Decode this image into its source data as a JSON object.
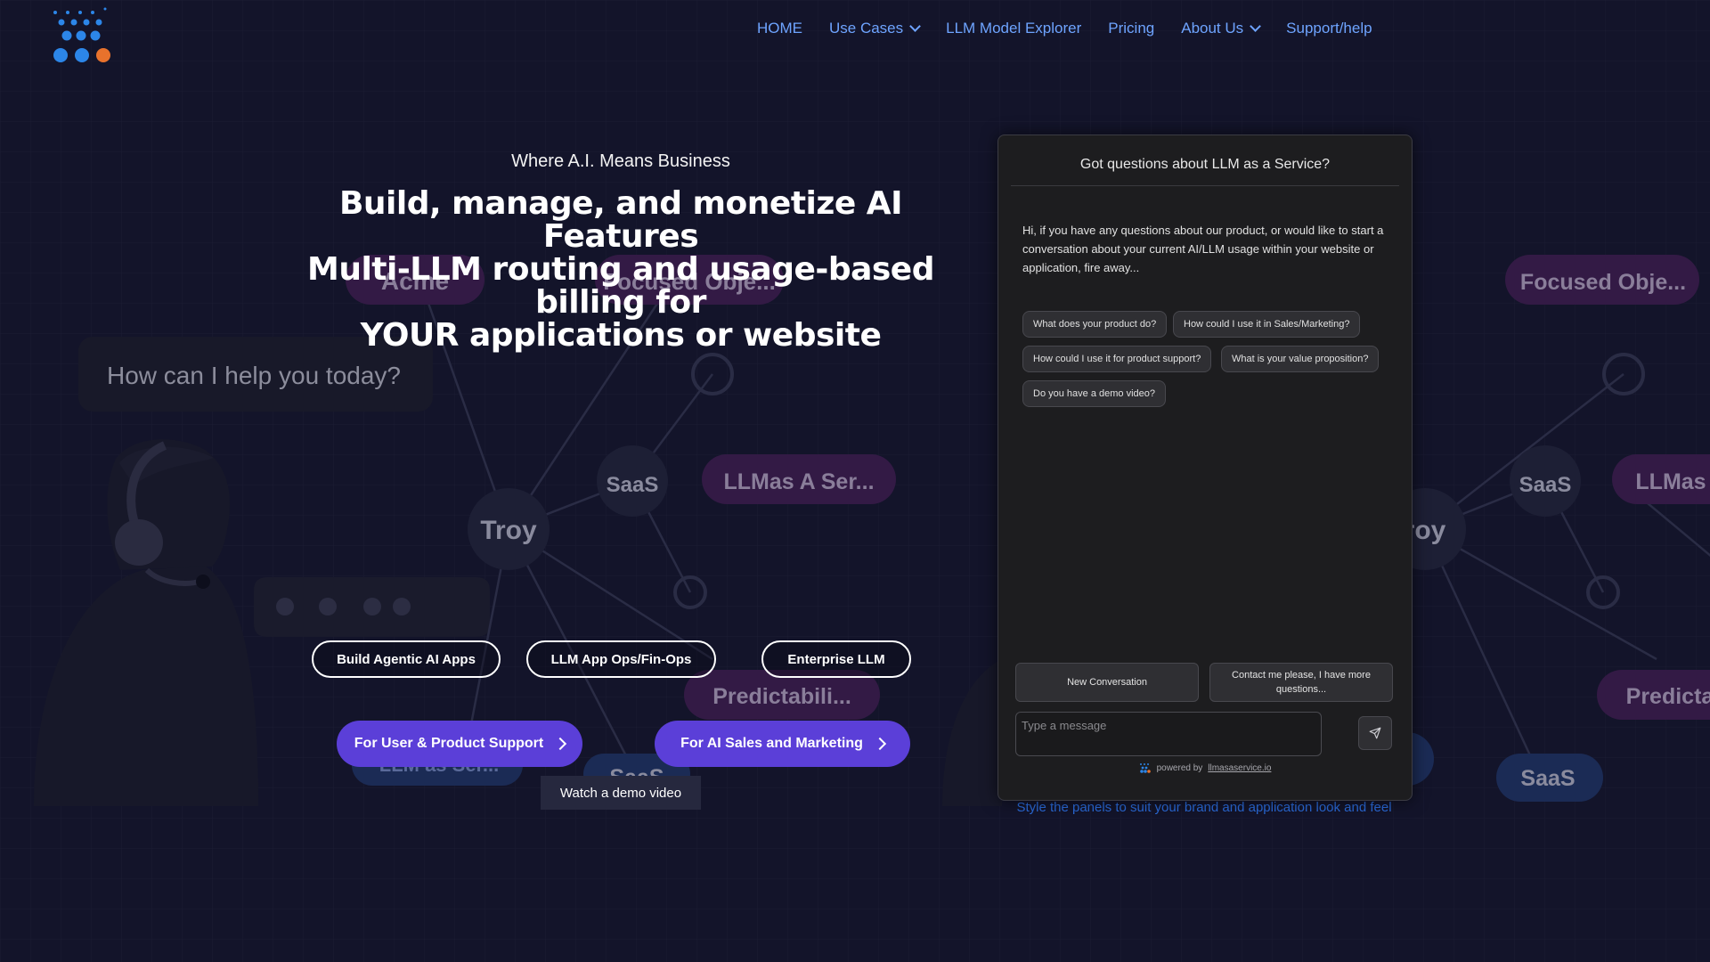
{
  "nav": {
    "items": [
      {
        "label": "HOME",
        "dropdown": false
      },
      {
        "label": "Use Cases",
        "dropdown": true
      },
      {
        "label": "LLM Model Explorer",
        "dropdown": false
      },
      {
        "label": "Pricing",
        "dropdown": false
      },
      {
        "label": "About Us",
        "dropdown": true
      },
      {
        "label": "Support/help",
        "dropdown": false
      }
    ]
  },
  "background": {
    "prompt_text": "How can I help you today?",
    "nodes": [
      "Acme",
      "Focused Obje...",
      "Troy",
      "SaaS",
      "LLMas A Ser...",
      "Predictabili...",
      "SaaS",
      "LLM as Ser...",
      "Focused Obje...",
      "SaaS",
      "LLMas",
      "roy",
      "Predicta",
      "SaaS"
    ]
  },
  "hero": {
    "tagline": "Where A.I. Means Business",
    "headline_1": "Build, manage, and monetize AI Features",
    "headline_2": "Multi-LLM routing and usage-based billing for",
    "headline_3": "YOUR applications or website",
    "outline_buttons": [
      "Build Agentic AI Apps",
      "LLM App Ops/Fin-Ops",
      "Enterprise LLM"
    ],
    "cta_support": "For User & Product Support",
    "cta_sales": "For AI Sales and Marketing",
    "demo_video": "Watch a demo video"
  },
  "chat": {
    "title": "Got questions about LLM as a Service?",
    "message": "Hi, if you have any questions about our product, or would like to start a conversation about your current AI/LLM usage within your website or application, fire away...",
    "suggestions": [
      "What does your product do?",
      "How could I use it in Sales/Marketing?",
      "How could I use it for product support?",
      "What is your value proposition?",
      "Do you have a demo video?"
    ],
    "new_conversation": "New Conversation",
    "contact": "Contact me please, I have more questions...",
    "input_placeholder": "Type a message",
    "powered_by": "powered by",
    "powered_link": "llmasaservice.io",
    "style_note": "Style the panels to suit your brand and application look and feel"
  },
  "colors": {
    "background": "#13142a",
    "nav_link": "#6ea4ff",
    "cta": "#5b3fd8",
    "style_note": "#2a6ad8",
    "logo_orange": "#e8722c",
    "logo_blue": "#2c86e8"
  }
}
